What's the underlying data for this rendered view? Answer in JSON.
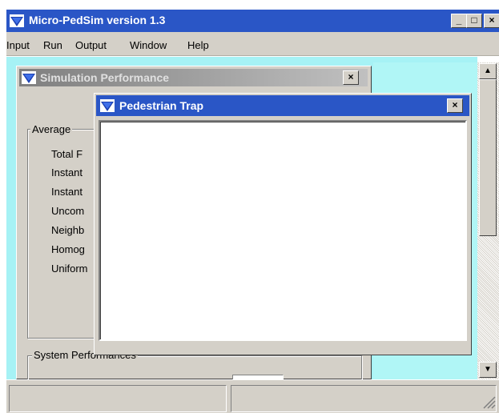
{
  "app": {
    "title": "Micro-PedSim version 1.3"
  },
  "menu": [
    "Input",
    "Run",
    "Output",
    "Window",
    "Help"
  ],
  "caption_buttons": {
    "minimize": "_",
    "maximize": "□",
    "close": "×"
  },
  "child_windows": {
    "simulation_performance": {
      "title": "Simulation Performance",
      "group_average_label": "Average",
      "stats": [
        "Total F",
        "Instant",
        "Instant",
        "Uncom",
        "Neighb",
        "Homog",
        "Uniform"
      ],
      "group_system_label": "System Performances"
    },
    "pedestrian_trap": {
      "title": "Pedestrian Trap"
    }
  },
  "colors": {
    "active_titlebar": "#2a56c6",
    "inactive_titlebar": "#7f7f7f",
    "mdi_background": "#a6f2f5",
    "face": "#d4d0c8"
  },
  "icons": [
    "app-icon",
    "window-icon",
    "minimize-icon",
    "maximize-icon",
    "close-icon",
    "scroll-up-icon",
    "scroll-down-icon",
    "resize-grip-icon"
  ]
}
